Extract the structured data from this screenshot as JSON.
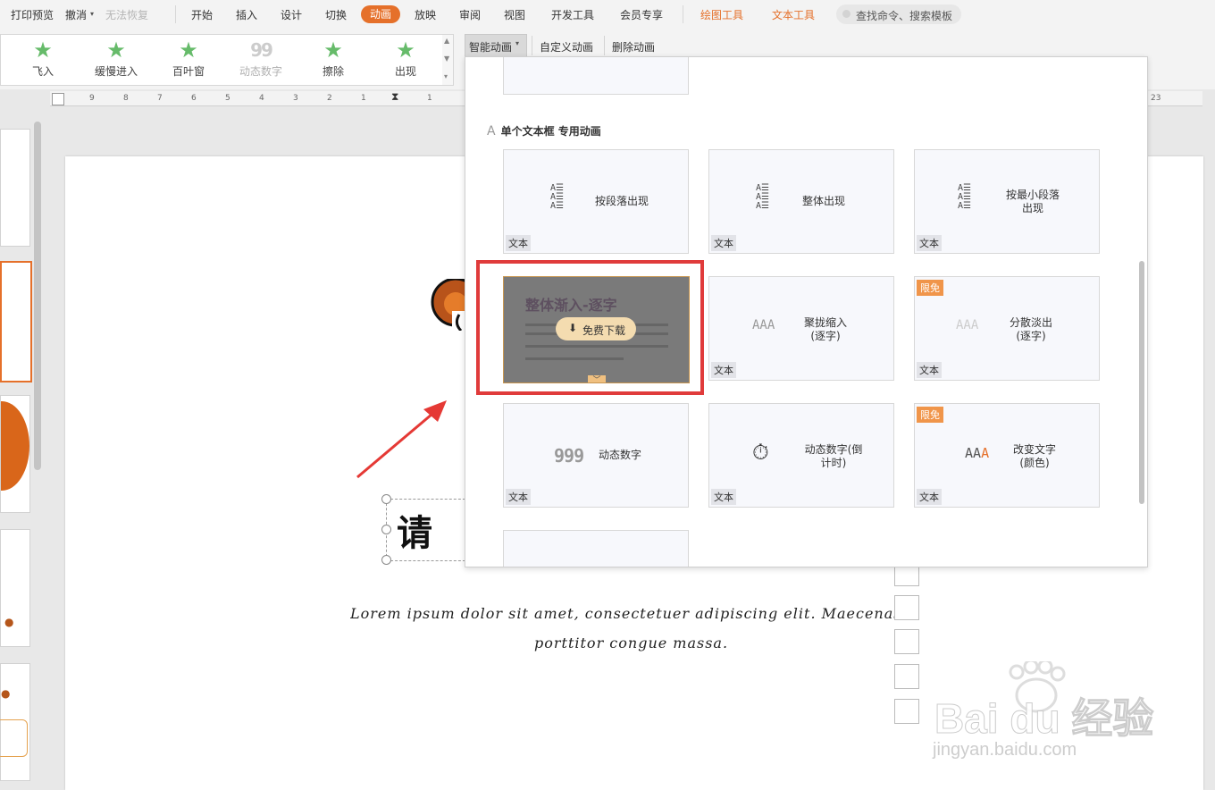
{
  "menubar": {
    "print_preview": "打印预览",
    "undo": "撤消",
    "redo_disabled": "无法恢复",
    "tabs": [
      "开始",
      "插入",
      "设计",
      "切换",
      "动画",
      "放映",
      "审阅",
      "视图",
      "开发工具",
      "会员专享"
    ],
    "active_tab": "动画",
    "context_tabs": [
      "绘图工具",
      "文本工具"
    ],
    "search_placeholder": "查找命令、搜索模板"
  },
  "ribbon": {
    "animations": [
      {
        "label": "飞入",
        "icon": "star-icon",
        "enabled": true
      },
      {
        "label": "缓慢进入",
        "icon": "star-icon",
        "enabled": true
      },
      {
        "label": "百叶窗",
        "icon": "star-icon",
        "enabled": true
      },
      {
        "label": "动态数字",
        "icon": "number-99-icon",
        "enabled": false
      },
      {
        "label": "擦除",
        "icon": "star-icon",
        "enabled": true
      },
      {
        "label": "出现",
        "icon": "star-icon",
        "enabled": true
      }
    ],
    "smart_animation": "智能动画",
    "custom_animation": "自定义动画",
    "delete_animation": "删除动画"
  },
  "ruler": {
    "ticks_left": [
      "9",
      "8",
      "7",
      "6",
      "5",
      "4",
      "3",
      "2",
      "1"
    ],
    "ticks_right": [
      "23"
    ]
  },
  "slide": {
    "char": "请",
    "lorem_line1": "Lorem ipsum dolor sit amet, consectetuer adipiscing elit. Maecenas",
    "lorem_line2": "porttitor congue massa."
  },
  "panel": {
    "heading": "单个文本框 专用动画",
    "heading_icon": "text-a-icon",
    "cards": [
      {
        "title": "按段落出现",
        "tag": "文本",
        "icon": "paragraph-icon",
        "badge": ""
      },
      {
        "title": "整体出现",
        "tag": "文本",
        "icon": "paragraph-icon",
        "badge": ""
      },
      {
        "title": "按最小段落出现",
        "tag": "文本",
        "icon": "paragraph-icon",
        "badge": ""
      },
      {
        "title": "聚拢缩入(逐字)",
        "tag": "文本",
        "icon": "aaa-icon",
        "badge": ""
      },
      {
        "title": "分散淡出(逐字)",
        "tag": "文本",
        "icon": "aaa-icon",
        "badge": "限免"
      },
      {
        "title": "动态数字",
        "tag": "文本",
        "icon": "999-icon",
        "badge": ""
      },
      {
        "title": "动态数字(倒计时)",
        "tag": "文本",
        "icon": "timer-icon",
        "badge": ""
      },
      {
        "title": "改变文字(颜色)",
        "tag": "文本",
        "icon": "aaa-color-icon",
        "badge": "限免"
      }
    ],
    "highlighted": {
      "title": "整体渐入-逐字",
      "download": "免费下载"
    }
  },
  "watermark": {
    "brand": "Bai du 经验",
    "url": "jingyan.baidu.com"
  }
}
